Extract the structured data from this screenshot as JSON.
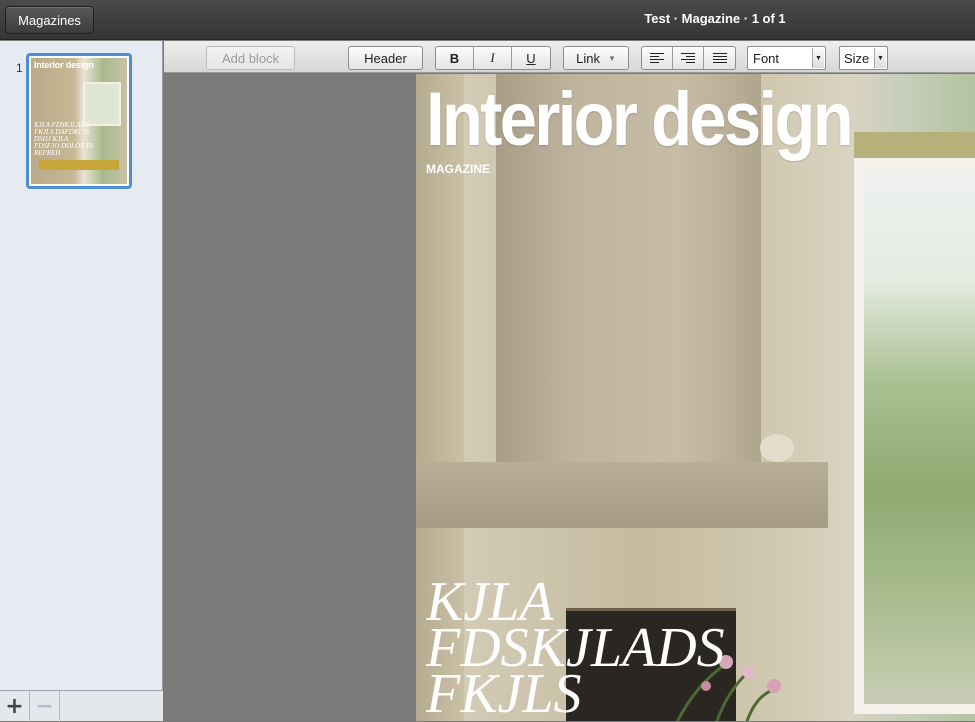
{
  "topbar": {
    "magazines_label": "Magazines",
    "title": "Test · Magazine · 1 of 1"
  },
  "sidebar": {
    "pages": [
      {
        "number": "1",
        "thumb_title": "Interior design",
        "thumb_text": "KJLA FDSKJLADS FKJLS DAFDKLJS DSHJ KJLA FDSFJO DOLOR IN REPREH",
        "selected": true
      }
    ],
    "add_icon": "plus-icon",
    "remove_icon": "minus-icon"
  },
  "toolbar": {
    "add_block_label": "Add block",
    "header_label": "Header",
    "bold_label": "B",
    "italic_label": "I",
    "underline_label": "U",
    "link_label": "Link",
    "align_left_icon": "align-left-icon",
    "align_right_icon": "align-right-icon",
    "align_justify_icon": "align-justify-icon",
    "font_value": "Font",
    "size_value": "Size"
  },
  "page": {
    "title": "Interior design",
    "subtitle": "MAGAZINE",
    "headline_lines": [
      "KJLA",
      "FDSKJLADS",
      "FKJLS"
    ]
  },
  "colors": {
    "selection": "#4d8fd6",
    "topbar": "#3c3c3c",
    "sidebar": "#e6ebf2",
    "canvas": "#7b7b7b"
  }
}
